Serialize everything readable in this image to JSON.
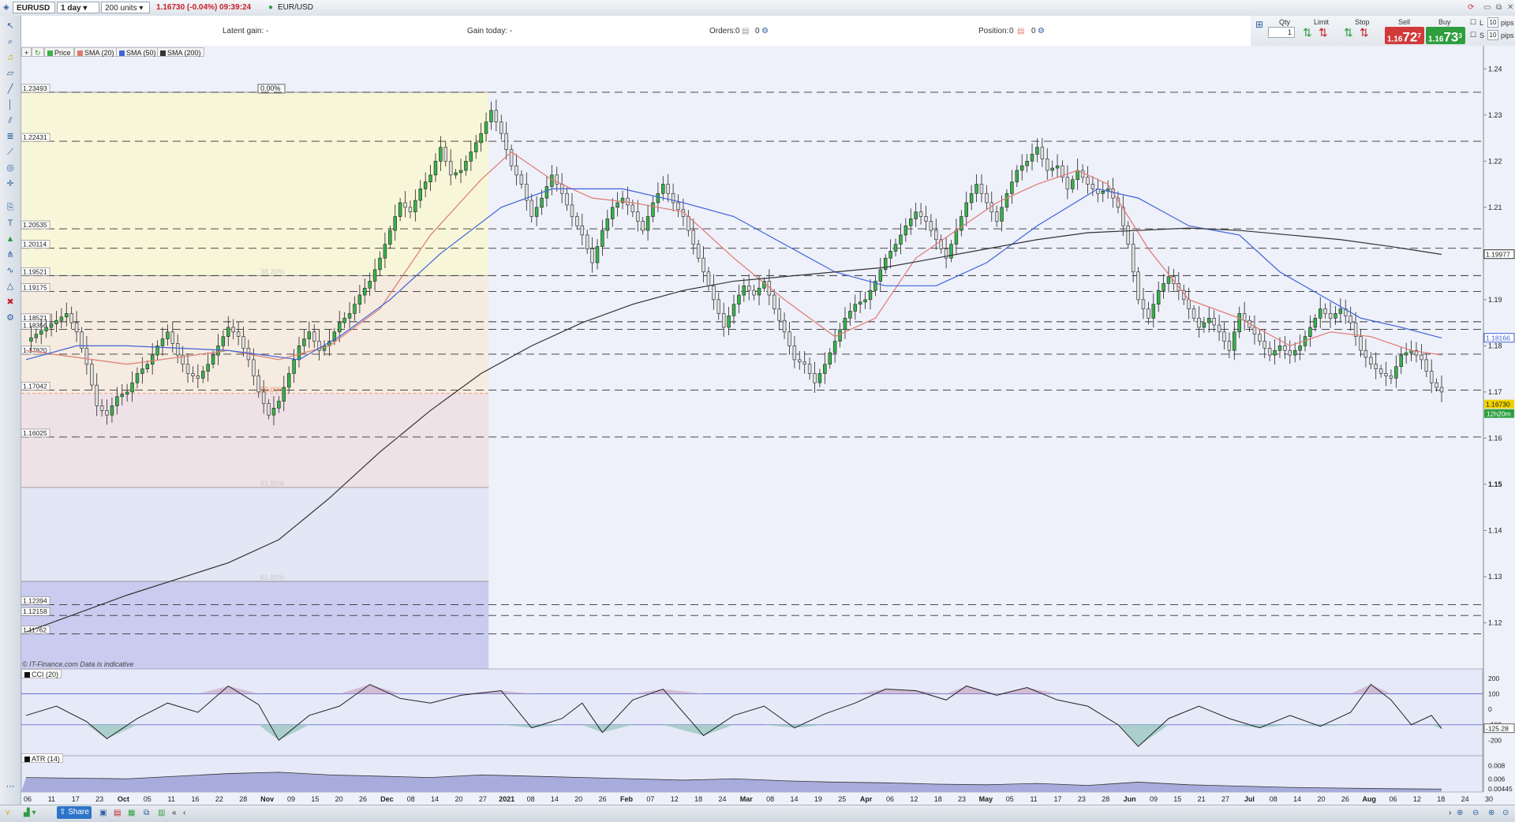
{
  "toolbar": {
    "symbol": "EURUSD",
    "interval": "1 day",
    "units": "200 units",
    "quote": "1.16730 (-0.04%) 09:39:24",
    "instrument": "EUR/USD"
  },
  "info": {
    "latent_gain": "Latent gain: -",
    "gain_today": "Gain today: -",
    "orders_label": "Orders:",
    "orders_value": "0",
    "orders_value2": "0",
    "position_label": "Position:",
    "position_value": "0",
    "position_value2": "0"
  },
  "order_panel": {
    "qty_label": "Qty",
    "qty_value": "1",
    "limit_label": "Limit",
    "stop_label": "Stop",
    "sell_label": "Sell",
    "buy_label": "Buy",
    "sell_small": "1.16",
    "sell_big": "72",
    "sell_sup": "7",
    "buy_small": "1.16",
    "buy_big": "73",
    "buy_sup": "3",
    "l_label": "L",
    "s_label": "S",
    "pips_top": "10",
    "pips_bottom": "10",
    "pips_label": "pips",
    "colors": {
      "sell": "#d23a3a",
      "buy": "#2e9e3e"
    }
  },
  "legend": {
    "price": "Price",
    "sma20": "SMA (20)",
    "sma50": "SMA (50)",
    "sma200": "SMA (200)",
    "colors": {
      "sma20": "#e07a70",
      "sma50": "#3f63d8",
      "sma200": "#333333",
      "bull": "#38b24a",
      "bear": "#e0e0e0"
    }
  },
  "watermark": "© IT-Finance.com  Data is indicative",
  "cci_label": "CCI (20)",
  "atr_label": "ATR (14)",
  "bottom": {
    "share": "Share"
  },
  "chart_data": {
    "type": "line",
    "title": "",
    "ylim": [
      1.11,
      1.245
    ],
    "price_ticks": [
      "1.24",
      "1.23",
      "1.22",
      "1.21",
      "1.2",
      "1.19",
      "1.18",
      "1.17",
      "1.16",
      "1.15",
      "1.14",
      "1.13",
      "1.12"
    ],
    "tick_values": [
      1.24,
      1.23,
      1.22,
      1.21,
      1.2,
      1.19,
      1.18,
      1.17,
      1.16,
      1.15,
      1.14,
      1.13,
      1.12
    ],
    "current_price": "1.16730",
    "countdown": "12h20m",
    "sma50_value": "1.18166",
    "sma200_value": "1.19977",
    "fib_labels": [
      "0.00%",
      "38.20%",
      "50.00%",
      "61.80%",
      "61.80%"
    ],
    "fib_values": [
      1.23493,
      1.19521,
      1.16968,
      1.14933,
      1.12898
    ],
    "levels": [
      {
        "value": 1.23493,
        "label": "1.23493"
      },
      {
        "value": 1.22431,
        "label": "1.22431"
      },
      {
        "value": 1.20535,
        "label": "1.20535"
      },
      {
        "value": 1.20114,
        "label": "1.20114"
      },
      {
        "value": 1.19521,
        "label": "1.19521"
      },
      {
        "value": 1.19175,
        "label": "1.19175"
      },
      {
        "value": 1.18521,
        "label": "1.18521"
      },
      {
        "value": 1.18356,
        "label": "1.18356"
      },
      {
        "value": 1.1782,
        "label": "1.17820"
      },
      {
        "value": 1.17042,
        "label": "1.17042"
      },
      {
        "value": 1.16025,
        "label": "1.16025"
      },
      {
        "value": 1.12394,
        "label": "1.12394"
      },
      {
        "value": 1.12158,
        "label": "1.12158"
      },
      {
        "value": 1.11762,
        "label": "1.11762"
      }
    ],
    "x_labels": [
      "06",
      "11",
      "17",
      "23",
      "Oct",
      "05",
      "11",
      "16",
      "22",
      "28",
      "Nov",
      "09",
      "15",
      "20",
      "26",
      "Dec",
      "08",
      "14",
      "20",
      "27",
      "2021",
      "08",
      "14",
      "20",
      "26",
      "Feb",
      "07",
      "12",
      "18",
      "24",
      "Mar",
      "08",
      "14",
      "19",
      "25",
      "Apr",
      "06",
      "12",
      "18",
      "23",
      "May",
      "05",
      "11",
      "17",
      "23",
      "28",
      "Jun",
      "09",
      "15",
      "21",
      "27",
      "Jul",
      "08",
      "14",
      "20",
      "26",
      "Aug",
      "06",
      "12",
      "18",
      "24",
      "30"
    ],
    "x_label_bold": [
      "Oct",
      "Nov",
      "Dec",
      "2021",
      "Feb",
      "Mar",
      "Apr",
      "May",
      "Jun",
      "Jul",
      "Aug"
    ],
    "close_path": [
      [
        0,
        1.181
      ],
      [
        4,
        1.184
      ],
      [
        8,
        1.187
      ],
      [
        10,
        1.183
      ],
      [
        12,
        1.176
      ],
      [
        14,
        1.167
      ],
      [
        16,
        1.165
      ],
      [
        18,
        1.169
      ],
      [
        20,
        1.17
      ],
      [
        22,
        1.174
      ],
      [
        24,
        1.176
      ],
      [
        26,
        1.18
      ],
      [
        28,
        1.183
      ],
      [
        30,
        1.178
      ],
      [
        32,
        1.174
      ],
      [
        34,
        1.173
      ],
      [
        36,
        1.176
      ],
      [
        38,
        1.18
      ],
      [
        40,
        1.184
      ],
      [
        42,
        1.182
      ],
      [
        44,
        1.177
      ],
      [
        46,
        1.17
      ],
      [
        48,
        1.165
      ],
      [
        50,
        1.168
      ],
      [
        52,
        1.174
      ],
      [
        54,
        1.18
      ],
      [
        56,
        1.183
      ],
      [
        58,
        1.179
      ],
      [
        60,
        1.181
      ],
      [
        62,
        1.185
      ],
      [
        64,
        1.187
      ],
      [
        66,
        1.191
      ],
      [
        68,
        1.194
      ],
      [
        70,
        1.199
      ],
      [
        72,
        1.205
      ],
      [
        74,
        1.211
      ],
      [
        76,
        1.209
      ],
      [
        78,
        1.214
      ],
      [
        80,
        1.217
      ],
      [
        82,
        1.223
      ],
      [
        84,
        1.217
      ],
      [
        86,
        1.218
      ],
      [
        88,
        1.222
      ],
      [
        90,
        1.226
      ],
      [
        92,
        1.231
      ],
      [
        94,
        1.226
      ],
      [
        96,
        1.219
      ],
      [
        98,
        1.215
      ],
      [
        100,
        1.208
      ],
      [
        102,
        1.212
      ],
      [
        104,
        1.217
      ],
      [
        106,
        1.213
      ],
      [
        108,
        1.208
      ],
      [
        110,
        1.204
      ],
      [
        112,
        1.198
      ],
      [
        114,
        1.205
      ],
      [
        116,
        1.21
      ],
      [
        118,
        1.212
      ],
      [
        120,
        1.209
      ],
      [
        122,
        1.205
      ],
      [
        124,
        1.211
      ],
      [
        126,
        1.215
      ],
      [
        128,
        1.211
      ],
      [
        130,
        1.208
      ],
      [
        132,
        1.202
      ],
      [
        134,
        1.196
      ],
      [
        136,
        1.19
      ],
      [
        138,
        1.184
      ],
      [
        140,
        1.189
      ],
      [
        142,
        1.193
      ],
      [
        144,
        1.191
      ],
      [
        146,
        1.194
      ],
      [
        148,
        1.188
      ],
      [
        150,
        1.183
      ],
      [
        152,
        1.177
      ],
      [
        154,
        1.176
      ],
      [
        156,
        1.172
      ],
      [
        158,
        1.176
      ],
      [
        160,
        1.181
      ],
      [
        162,
        1.186
      ],
      [
        164,
        1.189
      ],
      [
        166,
        1.19
      ],
      [
        168,
        1.194
      ],
      [
        170,
        1.199
      ],
      [
        172,
        1.202
      ],
      [
        174,
        1.206
      ],
      [
        176,
        1.209
      ],
      [
        178,
        1.207
      ],
      [
        180,
        1.203
      ],
      [
        182,
        1.199
      ],
      [
        184,
        1.205
      ],
      [
        186,
        1.211
      ],
      [
        188,
        1.215
      ],
      [
        190,
        1.211
      ],
      [
        192,
        1.207
      ],
      [
        194,
        1.213
      ],
      [
        196,
        1.218
      ],
      [
        198,
        1.22
      ],
      [
        200,
        1.223
      ],
      [
        202,
        1.218
      ],
      [
        204,
        1.219
      ],
      [
        206,
        1.214
      ],
      [
        208,
        1.218
      ],
      [
        210,
        1.215
      ],
      [
        212,
        1.213
      ],
      [
        214,
        1.214
      ],
      [
        216,
        1.21
      ],
      [
        218,
        1.202
      ],
      [
        220,
        1.19
      ],
      [
        222,
        1.186
      ],
      [
        224,
        1.192
      ],
      [
        226,
        1.195
      ],
      [
        228,
        1.192
      ],
      [
        230,
        1.188
      ],
      [
        232,
        1.184
      ],
      [
        234,
        1.186
      ],
      [
        236,
        1.183
      ],
      [
        238,
        1.179
      ],
      [
        240,
        1.187
      ],
      [
        242,
        1.184
      ],
      [
        244,
        1.181
      ],
      [
        246,
        1.178
      ],
      [
        248,
        1.18
      ],
      [
        250,
        1.178
      ],
      [
        252,
        1.18
      ],
      [
        254,
        1.184
      ],
      [
        256,
        1.188
      ],
      [
        258,
        1.186
      ],
      [
        260,
        1.188
      ],
      [
        262,
        1.185
      ],
      [
        264,
        1.179
      ],
      [
        266,
        1.176
      ],
      [
        268,
        1.174
      ],
      [
        270,
        1.173
      ],
      [
        272,
        1.178
      ],
      [
        274,
        1.179
      ],
      [
        276,
        1.177
      ],
      [
        278,
        1.172
      ],
      [
        280,
        1.17
      ]
    ],
    "series": [
      {
        "name": "SMA (20)",
        "points": [
          [
            0,
            1.179
          ],
          [
            20,
            1.176
          ],
          [
            40,
            1.179
          ],
          [
            50,
            1.177
          ],
          [
            60,
            1.18
          ],
          [
            70,
            1.188
          ],
          [
            80,
            1.204
          ],
          [
            90,
            1.216
          ],
          [
            96,
            1.222
          ],
          [
            104,
            1.216
          ],
          [
            112,
            1.212
          ],
          [
            120,
            1.211
          ],
          [
            130,
            1.209
          ],
          [
            140,
            1.199
          ],
          [
            150,
            1.19
          ],
          [
            160,
            1.182
          ],
          [
            168,
            1.186
          ],
          [
            176,
            1.199
          ],
          [
            184,
            1.205
          ],
          [
            192,
            1.211
          ],
          [
            200,
            1.215
          ],
          [
            208,
            1.218
          ],
          [
            214,
            1.215
          ],
          [
            222,
            1.201
          ],
          [
            230,
            1.19
          ],
          [
            240,
            1.186
          ],
          [
            250,
            1.18
          ],
          [
            258,
            1.183
          ],
          [
            266,
            1.182
          ],
          [
            274,
            1.179
          ],
          [
            280,
            1.178
          ]
        ]
      },
      {
        "name": "SMA (50)",
        "points": [
          [
            0,
            1.177
          ],
          [
            10,
            1.18
          ],
          [
            20,
            1.18
          ],
          [
            40,
            1.179
          ],
          [
            54,
            1.177
          ],
          [
            62,
            1.182
          ],
          [
            72,
            1.19
          ],
          [
            82,
            1.2
          ],
          [
            94,
            1.21
          ],
          [
            104,
            1.214
          ],
          [
            118,
            1.214
          ],
          [
            130,
            1.211
          ],
          [
            140,
            1.208
          ],
          [
            150,
            1.202
          ],
          [
            160,
            1.196
          ],
          [
            170,
            1.193
          ],
          [
            180,
            1.193
          ],
          [
            190,
            1.198
          ],
          [
            200,
            1.206
          ],
          [
            212,
            1.214
          ],
          [
            220,
            1.212
          ],
          [
            230,
            1.206
          ],
          [
            240,
            1.204
          ],
          [
            248,
            1.196
          ],
          [
            256,
            1.191
          ],
          [
            264,
            1.186
          ],
          [
            272,
            1.184
          ],
          [
            280,
            1.1817
          ]
        ]
      },
      {
        "name": "SMA (200)",
        "points": [
          [
            0,
            1.118
          ],
          [
            20,
            1.126
          ],
          [
            40,
            1.133
          ],
          [
            50,
            1.138
          ],
          [
            60,
            1.147
          ],
          [
            70,
            1.157
          ],
          [
            80,
            1.166
          ],
          [
            90,
            1.174
          ],
          [
            100,
            1.18
          ],
          [
            110,
            1.185
          ],
          [
            120,
            1.189
          ],
          [
            130,
            1.192
          ],
          [
            140,
            1.194
          ],
          [
            150,
            1.195
          ],
          [
            160,
            1.196
          ],
          [
            170,
            1.197
          ],
          [
            180,
            1.199
          ],
          [
            190,
            1.201
          ],
          [
            200,
            1.203
          ],
          [
            210,
            1.2045
          ],
          [
            220,
            1.205
          ],
          [
            230,
            1.2055
          ],
          [
            240,
            1.205
          ],
          [
            250,
            1.204
          ],
          [
            260,
            1.203
          ],
          [
            270,
            1.2015
          ],
          [
            280,
            1.1998
          ]
        ]
      }
    ],
    "cci_ticks": [
      "200",
      "100",
      "0",
      "-100",
      "-200"
    ],
    "cci_tick_values": [
      200,
      100,
      0,
      -100,
      -200
    ],
    "cci_value": "-125.28",
    "cci_points": [
      [
        0,
        -40
      ],
      [
        6,
        20
      ],
      [
        12,
        -80
      ],
      [
        16,
        -190
      ],
      [
        22,
        -60
      ],
      [
        28,
        40
      ],
      [
        34,
        -20
      ],
      [
        40,
        150
      ],
      [
        46,
        30
      ],
      [
        50,
        -200
      ],
      [
        56,
        -40
      ],
      [
        62,
        20
      ],
      [
        68,
        160
      ],
      [
        74,
        70
      ],
      [
        80,
        40
      ],
      [
        86,
        90
      ],
      [
        94,
        120
      ],
      [
        100,
        -120
      ],
      [
        106,
        -60
      ],
      [
        110,
        40
      ],
      [
        114,
        -150
      ],
      [
        120,
        60
      ],
      [
        126,
        130
      ],
      [
        134,
        -170
      ],
      [
        140,
        -40
      ],
      [
        146,
        20
      ],
      [
        152,
        -120
      ],
      [
        158,
        -30
      ],
      [
        164,
        40
      ],
      [
        170,
        130
      ],
      [
        176,
        120
      ],
      [
        182,
        60
      ],
      [
        186,
        150
      ],
      [
        192,
        90
      ],
      [
        198,
        140
      ],
      [
        204,
        60
      ],
      [
        210,
        20
      ],
      [
        216,
        -100
      ],
      [
        220,
        -240
      ],
      [
        226,
        -60
      ],
      [
        232,
        20
      ],
      [
        238,
        -60
      ],
      [
        244,
        -120
      ],
      [
        250,
        -40
      ],
      [
        256,
        -110
      ],
      [
        262,
        -20
      ],
      [
        266,
        160
      ],
      [
        270,
        60
      ],
      [
        274,
        -100
      ],
      [
        278,
        -40
      ],
      [
        280,
        -125
      ]
    ],
    "atr_ticks": [
      "0.008",
      "0.006",
      "0.00445"
    ],
    "atr_tick_values": [
      0.008,
      0.006,
      0.00445
    ],
    "atr_points": [
      [
        0,
        0.0062
      ],
      [
        20,
        0.006
      ],
      [
        40,
        0.0068
      ],
      [
        50,
        0.007
      ],
      [
        60,
        0.0066
      ],
      [
        70,
        0.0064
      ],
      [
        80,
        0.0062
      ],
      [
        90,
        0.0066
      ],
      [
        100,
        0.0064
      ],
      [
        110,
        0.0062
      ],
      [
        120,
        0.006
      ],
      [
        130,
        0.0058
      ],
      [
        140,
        0.006
      ],
      [
        150,
        0.0057
      ],
      [
        160,
        0.0055
      ],
      [
        170,
        0.0054
      ],
      [
        180,
        0.0052
      ],
      [
        190,
        0.0051
      ],
      [
        200,
        0.0053
      ],
      [
        210,
        0.005
      ],
      [
        220,
        0.0055
      ],
      [
        230,
        0.0051
      ],
      [
        240,
        0.0049
      ],
      [
        250,
        0.0047
      ],
      [
        260,
        0.0046
      ],
      [
        270,
        0.0045
      ],
      [
        280,
        0.00445
      ]
    ]
  }
}
